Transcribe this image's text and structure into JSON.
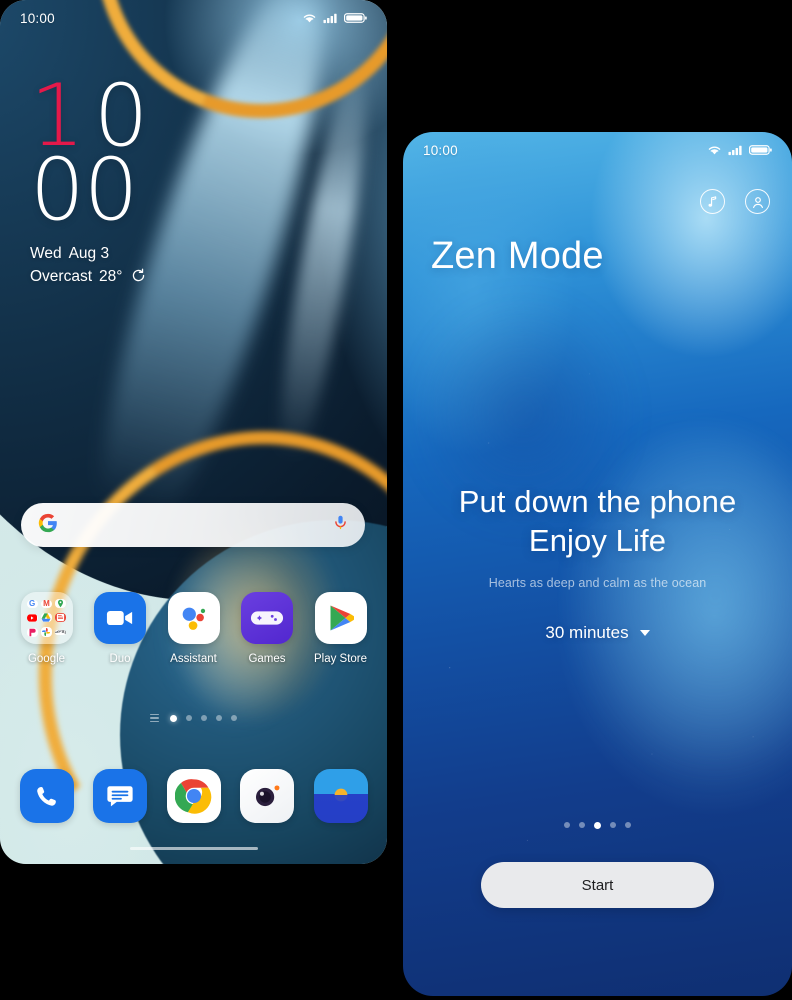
{
  "background_color": "#000000",
  "home_screen": {
    "status_bar": {
      "time": "10:00",
      "icons": [
        "wifi-icon",
        "signal-icon",
        "battery-icon"
      ]
    },
    "clock_widget": {
      "hour_first": "1",
      "hour_second": "0",
      "minutes": "00",
      "accent_color": "#e4194a",
      "date": "Wed",
      "date_month_day": "Aug 3",
      "weather_condition": "Overcast",
      "temperature": "28°",
      "refresh_icon": "refresh-icon"
    },
    "search_bar": {
      "leading_icon": "google-g-icon",
      "placeholder": "",
      "value": "",
      "trailing_icon": "microphone-icon"
    },
    "apps": [
      {
        "label": "Google",
        "icon": "google-folder-icon",
        "folder_items": [
          "G",
          "M",
          "Maps",
          "YouTube",
          "Drive",
          "News",
          "Play Movies",
          "Photos",
          "Google Pay"
        ]
      },
      {
        "label": "Duo",
        "icon": "duo-video-icon"
      },
      {
        "label": "Assistant",
        "icon": "google-assistant-icon"
      },
      {
        "label": "Games",
        "icon": "games-gamepad-icon"
      },
      {
        "label": "Play Store",
        "icon": "play-store-icon"
      }
    ],
    "page_indicator": {
      "total": 5,
      "active_index": 0,
      "menu_icon": "page-menu-icon"
    },
    "dock": [
      {
        "label": "Phone",
        "icon": "phone-icon"
      },
      {
        "label": "Messages",
        "icon": "messages-icon"
      },
      {
        "label": "Chrome",
        "icon": "chrome-icon"
      },
      {
        "label": "Camera",
        "icon": "camera-icon"
      },
      {
        "label": "Gallery",
        "icon": "gallery-icon"
      }
    ],
    "home_indicator": "home-indicator-bar"
  },
  "zen_screen": {
    "status_bar": {
      "time": "10:00",
      "icons": [
        "wifi-icon",
        "signal-icon",
        "battery-icon"
      ]
    },
    "top_icons": [
      {
        "name": "music-note-icon"
      },
      {
        "name": "profile-icon"
      }
    ],
    "title": "Zen Mode",
    "headline_line1": "Put down the phone",
    "headline_line2": "Enjoy Life",
    "subtitle": "Hearts as deep and calm as the ocean",
    "duration_value": "30 minutes",
    "duration_caret": "chevron-down-icon",
    "page_indicator": {
      "total": 5,
      "active_index": 2
    },
    "start_button": "Start"
  }
}
